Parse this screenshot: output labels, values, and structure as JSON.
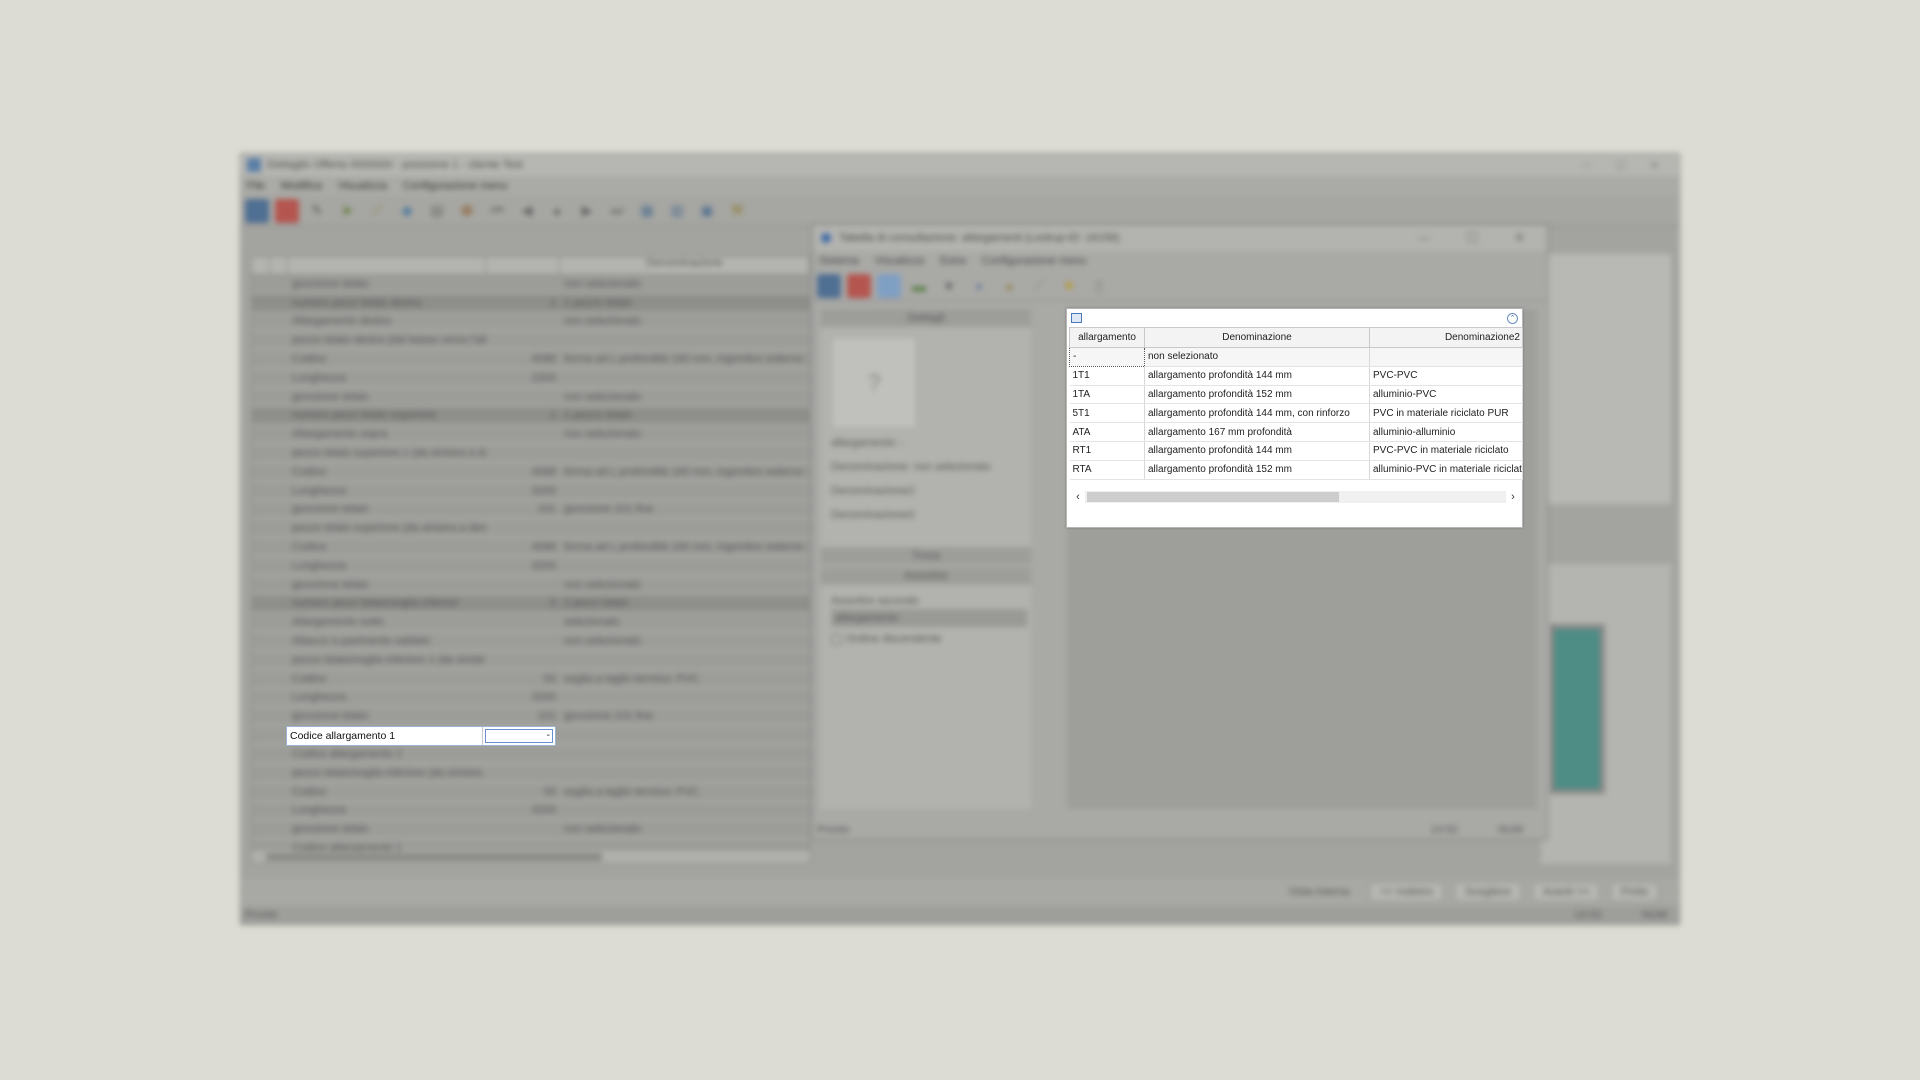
{
  "main_window": {
    "title": "Dettaglio Offerta 0000000 - posizione 1 - cliente Test",
    "menu": [
      "File",
      "Modifica",
      "Visualizza",
      "Configurazione menu"
    ],
    "toolbar_icons": [
      "settings-icon",
      "stop-icon",
      "tools-icon",
      "arrow-icon",
      "ruler-icon",
      "shapes-icon",
      "document-icon",
      "palette-icon",
      "first-icon",
      "prev-icon",
      "record-icon",
      "next-icon",
      "last-icon",
      "grid-icon",
      "layout-icon",
      "window-icon",
      "wrench-icon"
    ],
    "grid_header": {
      "col3": "Denominazione"
    },
    "grid_rows": [
      {
        "name": "giunzione telaio",
        "value": "",
        "desc": "non selezionato",
        "dark": false
      },
      {
        "name": "numero pezzi telaio destra",
        "value": "1",
        "desc": "1 pezzo telaio",
        "dark": true
      },
      {
        "name": "Allargamento destra",
        "value": "",
        "desc": "non selezionato",
        "dark": false
      },
      {
        "name": "pezzo telaio destra (dal basso verso l'alto)",
        "value": "",
        "desc": "",
        "dark": false
      },
      {
        "name": "Codice",
        "value": "4088",
        "desc": "forma ad L profondità 160 mm, ingombro esterno: 21",
        "dark": false
      },
      {
        "name": "Lunghezza",
        "value": "2200",
        "desc": "",
        "dark": false
      },
      {
        "name": "giunzione telaio",
        "value": "",
        "desc": "non selezionato",
        "dark": false
      },
      {
        "name": "numero pezzi telaio superiore",
        "value": "1",
        "desc": "1 pezzo telaio",
        "dark": true
      },
      {
        "name": "Allargamento sopra",
        "value": "",
        "desc": "non selezionato",
        "dark": false
      },
      {
        "name": "pezzo telaio superiore 1 (da sinistra a destr",
        "value": "",
        "desc": "",
        "dark": false
      },
      {
        "name": "Codice",
        "value": "4088",
        "desc": "forma ad L profondità 160 mm, ingombro esterno: 21",
        "dark": false
      },
      {
        "name": "Lunghezza",
        "value": "3200",
        "desc": "",
        "dark": false
      },
      {
        "name": "giunzione telaio",
        "value": "101",
        "desc": "giunzione 101 fine",
        "dark": false
      },
      {
        "name": "pezzo telaio superiore (da sinistra a destra)",
        "value": "",
        "desc": "",
        "dark": false
      },
      {
        "name": "Codice",
        "value": "4088",
        "desc": "forma ad L profondità 160 mm, ingombro esterno: 21",
        "dark": false
      },
      {
        "name": "Lunghezza",
        "value": "3200",
        "desc": "",
        "dark": false
      },
      {
        "name": "giunzione telaio",
        "value": "",
        "desc": "non selezionato",
        "dark": false
      },
      {
        "name": "numero pezzi telaio/soglia inferiori",
        "value": "2",
        "desc": "2 pezzi telaio",
        "dark": true
      },
      {
        "name": "Allargamento sotto",
        "value": "",
        "desc": "selezionato",
        "dark": false
      },
      {
        "name": "Attacco a pavimento saldato",
        "value": "",
        "desc": "non selezionato",
        "dark": false
      },
      {
        "name": "pezzo telaio/soglia inferiore 1 (da sinistra a",
        "value": "",
        "desc": "",
        "dark": false
      },
      {
        "name": "Codice",
        "value": "93",
        "desc": "soglia a taglio termico: PVC",
        "dark": false
      },
      {
        "name": "Lunghezza",
        "value": "3200",
        "desc": "",
        "dark": false
      },
      {
        "name": "giunzione telaio",
        "value": "101",
        "desc": "giunzione 101 fine",
        "dark": false
      }
    ],
    "active_row": {
      "label": "Codice allargamento 1",
      "value": "-"
    },
    "grid_rows_after": [
      {
        "name": "Codice allargamento 2",
        "value": "",
        "desc": "",
        "dark": false
      },
      {
        "name": "pezzo telaio/soglia inferiore (da sinistra a d",
        "value": "",
        "desc": "",
        "dark": false
      },
      {
        "name": "Codice",
        "value": "93",
        "desc": "soglia a taglio termico: PVC",
        "dark": false
      },
      {
        "name": "Lunghezza",
        "value": "3200",
        "desc": "",
        "dark": false
      },
      {
        "name": "giunzione telaio",
        "value": "",
        "desc": "non selezionato",
        "dark": false
      },
      {
        "name": "Codice allargamento 1",
        "value": "",
        "desc": "",
        "dark": false
      }
    ],
    "bottom_buttons": {
      "vista": "Vista interna",
      "back": "<< Indietro",
      "choose": "Scegliere",
      "next": "Avanti >>",
      "finish": "Finito"
    },
    "status": {
      "left": "Pronto",
      "time": "14:52",
      "num": "NUM"
    }
  },
  "lookup_window": {
    "title": "Tabella di consultazione: allargamenti (Lookup-ID: 16156)",
    "menu": [
      "Sistema",
      "Visualizza",
      "Extra",
      "Configurazione menu"
    ],
    "toolbar_icons": [
      "settings-icon",
      "stop-icon",
      "table-icon",
      "image-icon",
      "filter-icon",
      "save-icon",
      "palette-icon",
      "pencil-icon",
      "star-icon",
      "document-icon"
    ],
    "details": {
      "header": "Dettagli",
      "placeholder": "?",
      "fields": [
        "allargamento: -",
        "Denominazione: non selezionato",
        "Denominazione2:",
        "Denominazione3:"
      ],
      "search_header": "Trova",
      "filter_header": "Assortire",
      "sort_label": "Assortire secondo",
      "sort_value": "allargamento",
      "descending_label": "Ordine discendente"
    },
    "grid": {
      "columns": [
        "allargamento",
        "Denominazione",
        "Denominazione2"
      ],
      "rows": [
        {
          "code": "-",
          "name": "non selezionato",
          "name2": "",
          "selected": true
        },
        {
          "code": "1T1",
          "name": "allargamento profondità 144 mm",
          "name2": "PVC-PVC"
        },
        {
          "code": "1TA",
          "name": "allargamento profondità 152 mm",
          "name2": "alluminio-PVC"
        },
        {
          "code": "5T1",
          "name": "allargamento profondità 144 mm, con rinforzo",
          "name2": "PVC in materiale riciclato PUR"
        },
        {
          "code": "ATA",
          "name": "allargamento 167 mm profondità",
          "name2": "alluminio-alluminio"
        },
        {
          "code": "RT1",
          "name": "allargamento profondità 144 mm",
          "name2": "PVC-PVC in materiale riciclato"
        },
        {
          "code": "RTA",
          "name": "allargamento profondità 152 mm",
          "name2": "alluminio-PVC in materiale riciclato"
        }
      ]
    },
    "status": {
      "left": "Pronto",
      "time": "14:52",
      "num": "NUM"
    }
  }
}
